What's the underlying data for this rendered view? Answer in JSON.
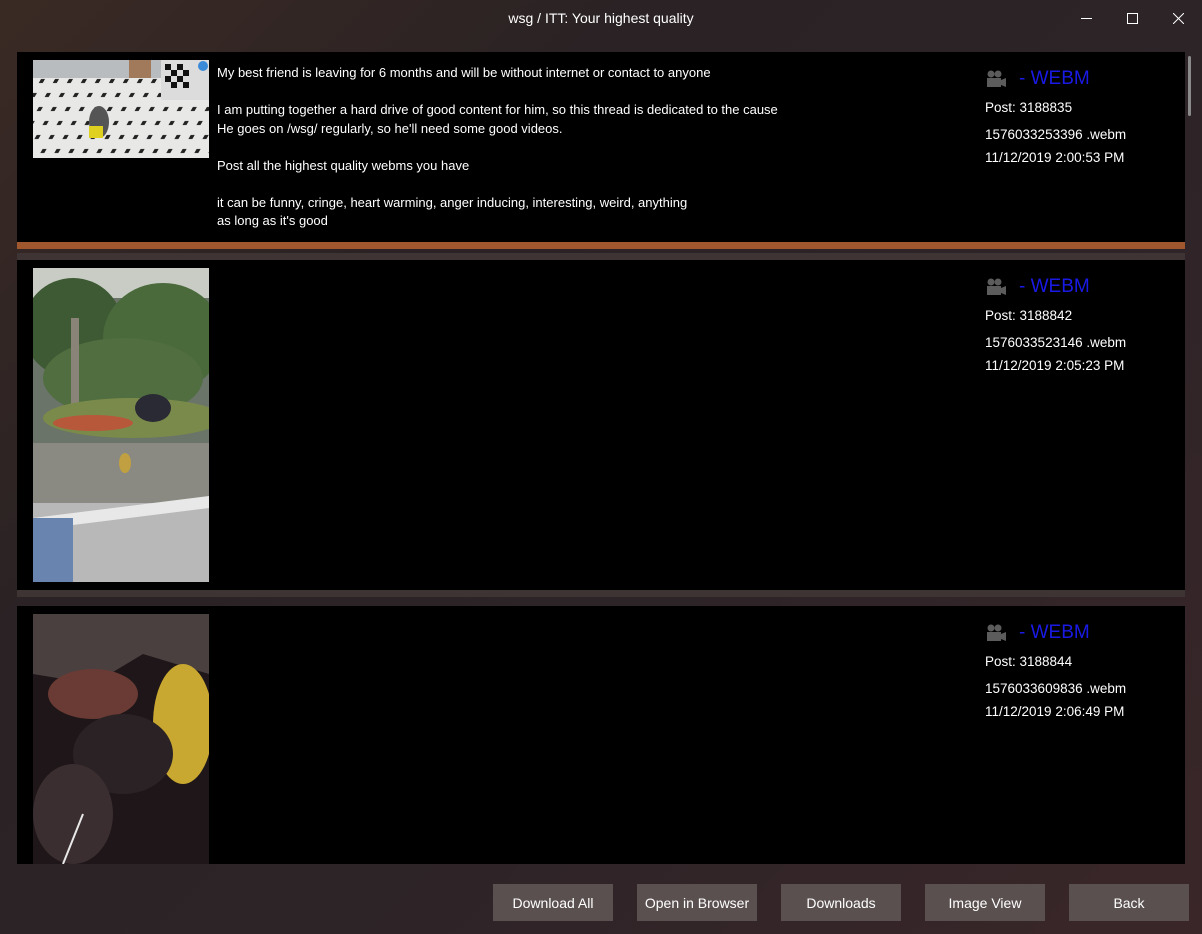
{
  "window": {
    "title": "wsg / ITT: Your highest quality"
  },
  "posts": [
    {
      "type_label": "- WEBM",
      "post_id": "Post: 3188835",
      "filename": "1576033253396 .webm",
      "datetime": "11/12/2019 2:00:53 PM",
      "text": "My best friend is leaving for 6 months and will be without internet or contact to anyone\n\nI am putting together a hard drive of good content for him, so this thread is dedicated to the cause\nHe goes on /wsg/ regularly, so he'll need some good videos.\n\nPost all the highest quality webms you have\n\nit can be funny, cringe, heart warming, anger inducing, interesting, weird, anything\nas long as it's good"
    },
    {
      "type_label": "- WEBM",
      "post_id": "Post: 3188842",
      "filename": "1576033523146 .webm",
      "datetime": "11/12/2019 2:05:23 PM",
      "text": ""
    },
    {
      "type_label": "- WEBM",
      "post_id": "Post: 3188844",
      "filename": "1576033609836 .webm",
      "datetime": "11/12/2019 2:06:49 PM",
      "text": ""
    }
  ],
  "buttons": {
    "download_all": "Download All",
    "open_in_browser": "Open in Browser",
    "downloads": "Downloads",
    "image_view": "Image View",
    "back": "Back"
  },
  "icons": {
    "type_icon": "video-camera-icon",
    "minimize": "minimize-icon",
    "maximize": "maximize-icon",
    "close": "close-icon"
  },
  "colors": {
    "selected_border": "#a0572e",
    "type_label": "#1a1ae6",
    "button_bg": "#5a5050"
  }
}
